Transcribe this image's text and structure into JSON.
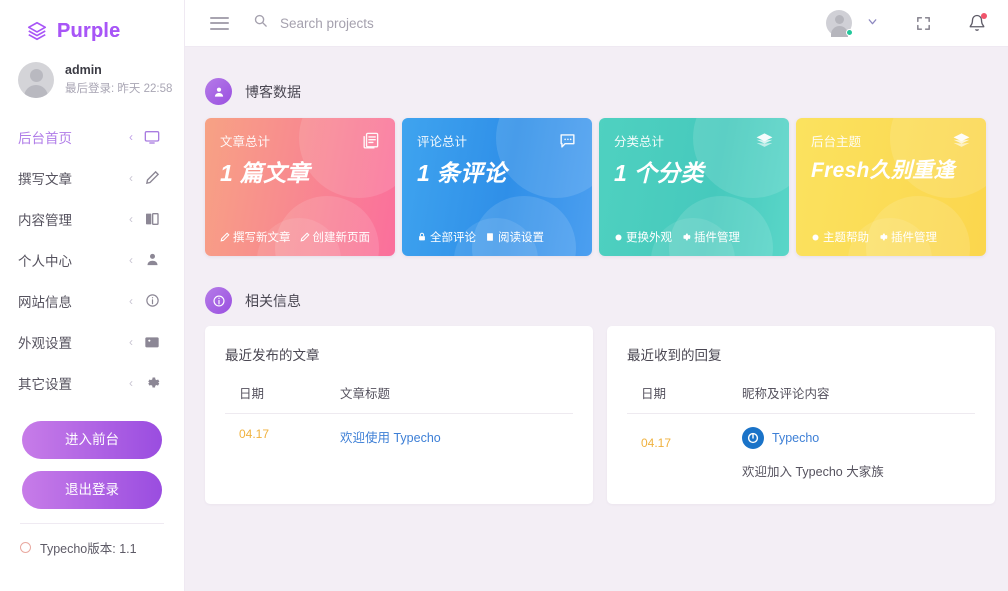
{
  "brand": {
    "name": "Purple",
    "icon": "layers-icon"
  },
  "user": {
    "name": "admin",
    "last_login": "最后登录: 昨天 22:58",
    "avatar_icon": "avatar"
  },
  "sidebar": {
    "items": [
      {
        "label": "后台首页",
        "icon": "monitor-icon",
        "chevron": "‹",
        "active": true
      },
      {
        "label": "撰写文章",
        "icon": "pencil-icon",
        "chevron": "‹",
        "active": false
      },
      {
        "label": "内容管理",
        "icon": "book-icon",
        "chevron": "‹",
        "active": false
      },
      {
        "label": "个人中心",
        "icon": "user-icon",
        "chevron": "‹",
        "active": false
      },
      {
        "label": "网站信息",
        "icon": "info-icon",
        "chevron": "‹",
        "active": false
      },
      {
        "label": "外观设置",
        "icon": "image-icon",
        "chevron": "‹",
        "active": false
      },
      {
        "label": "其它设置",
        "icon": "gear-icon",
        "chevron": "‹",
        "active": false
      }
    ],
    "buttons": [
      {
        "label": "进入前台"
      },
      {
        "label": "退出登录"
      }
    ],
    "version": "Typecho版本: 1.1"
  },
  "header": {
    "menu_icon": "hamburger-icon",
    "search": {
      "placeholder": "Search projects",
      "value": "",
      "icon": "search-icon"
    },
    "fullscreen_icon": "fullscreen-icon",
    "bell_icon": "bell-icon",
    "chevron_icon": "chevron-down-icon",
    "has_notification": true,
    "status_online": true
  },
  "main": {
    "sections": [
      {
        "title": "博客数据",
        "icon": "user-circle-icon"
      },
      {
        "title": "相关信息",
        "icon": "info-circle-icon"
      }
    ],
    "cards": [
      {
        "label": "文章总计",
        "value": "1 篇文章",
        "icon": "articles-icon",
        "theme": "c1",
        "links": [
          {
            "label": "撰写新文章",
            "icon": "pencil-icon"
          },
          {
            "label": "创建新页面",
            "icon": "pencil-icon"
          }
        ]
      },
      {
        "label": "评论总计",
        "value": "1 条评论",
        "icon": "comment-icon",
        "theme": "c2",
        "links": [
          {
            "label": "全部评论",
            "icon": "lock-icon"
          },
          {
            "label": "阅读设置",
            "icon": "book-icon"
          }
        ]
      },
      {
        "label": "分类总计",
        "value": "1 个分类",
        "icon": "layers-icon",
        "theme": "c3",
        "links": [
          {
            "label": "更换外观",
            "icon": "dot-icon"
          },
          {
            "label": "插件管理",
            "icon": "gear-icon"
          }
        ]
      },
      {
        "label": "后台主题",
        "value": "Fresh久别重逢",
        "icon": "layers-icon",
        "theme": "c4",
        "links": [
          {
            "label": "主题帮助",
            "icon": "dot-icon"
          },
          {
            "label": "插件管理",
            "icon": "gear-icon"
          }
        ]
      }
    ],
    "panels": {
      "posts": {
        "title": "最近发布的文章",
        "columns": [
          "日期",
          "文章标题"
        ],
        "rows": [
          {
            "date": "04.17",
            "title": "欢迎使用 Typecho"
          }
        ]
      },
      "comments": {
        "title": "最近收到的回复",
        "columns": [
          "日期",
          "昵称及评论内容"
        ],
        "rows": [
          {
            "date": "04.17",
            "author": "Typecho",
            "text": "欢迎加入 Typecho 大家族",
            "avatar_icon": "typecho-logo-icon"
          }
        ]
      }
    }
  },
  "colors": {
    "accent": "#a855f7",
    "background": "#f3eef5",
    "card1": "#fa6f9c",
    "card2": "#2f8fe8",
    "card3": "#46c9bd",
    "card4": "#fbd64d",
    "date": "#f0b23f",
    "link": "#3d7fd6",
    "online": "#22c79b",
    "notification": "#f0546b"
  }
}
